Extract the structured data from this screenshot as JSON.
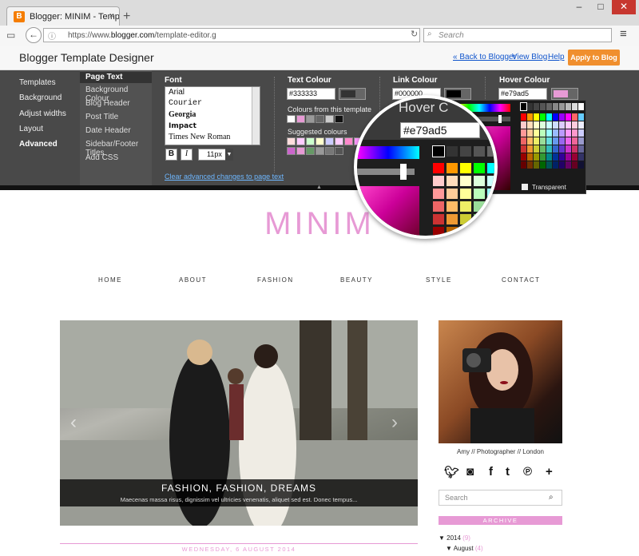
{
  "browser": {
    "tab_title": "Blogger: MINIM - Templat...",
    "tab_close": "×",
    "new_tab": "+",
    "url_prefix": "https://www.",
    "url_domain": "blogger.com",
    "url_path": "/template-editor.g",
    "search_placeholder": "Search",
    "min": "–",
    "max": "□",
    "close": "✕",
    "menu": "≡",
    "fav": "B"
  },
  "header": {
    "title": "Blogger Template Designer",
    "back_link": "« Back to Blogger",
    "view_blog": "View Blog",
    "help": "Help",
    "apply": "Apply to Blog"
  },
  "nav_main": [
    "Templates",
    "Background",
    "Adjust widths",
    "Layout",
    "Advanced"
  ],
  "nav_sub": [
    "Page Text",
    "Background Colour",
    "Blog Header",
    "Post Title",
    "Date Header",
    "Sidebar/Footer Titles",
    "Add CSS"
  ],
  "font": {
    "label": "Font",
    "options": [
      "Arial",
      "Courier",
      "Georgia",
      "Impact",
      "Times New Roman"
    ],
    "bold": "B",
    "italic": "I",
    "size": "11px",
    "clear_link": "Clear advanced changes to page text"
  },
  "text_colour": {
    "label": "Text Colour",
    "value": "#333333",
    "from_template": "Colours from this template",
    "suggested": "Suggested colours"
  },
  "link_colour": {
    "label": "Link Colour",
    "value": "#000000",
    "partial": "Co"
  },
  "hover_colour": {
    "label": "Hover Colour",
    "value": "#e79ad5",
    "mag_label": "Hover C",
    "transparent": "Transparent"
  },
  "colors": {
    "accent": "#e79ad5",
    "apply": "#f08f2e"
  },
  "blog": {
    "title": "MINIM",
    "menu": [
      "HOME",
      "ABOUT",
      "FASHION",
      "BEAUTY",
      "STYLE",
      "CONTACT"
    ],
    "caption_title": "FASHION, FASHION, DREAMS",
    "caption_text": "Maecenas massa risus, dignissim vel ultricies venenatis, aliquet sed est. Donec tempus...",
    "about": "Amy // Photographer // London",
    "search_placeholder": "Search",
    "archive": "ARCHIVE",
    "archive_year": "2014",
    "archive_year_count": "(9)",
    "archive_month": "August",
    "archive_month_count": "(4)",
    "date": "WEDNESDAY, 6 AUGUST 2014",
    "arrow_left": "‹",
    "arrow_right": "›"
  },
  "social_icons": [
    "twitter-icon",
    "instagram-icon",
    "facebook-icon",
    "tumblr-icon",
    "pinterest-icon",
    "bloglovin-icon"
  ]
}
